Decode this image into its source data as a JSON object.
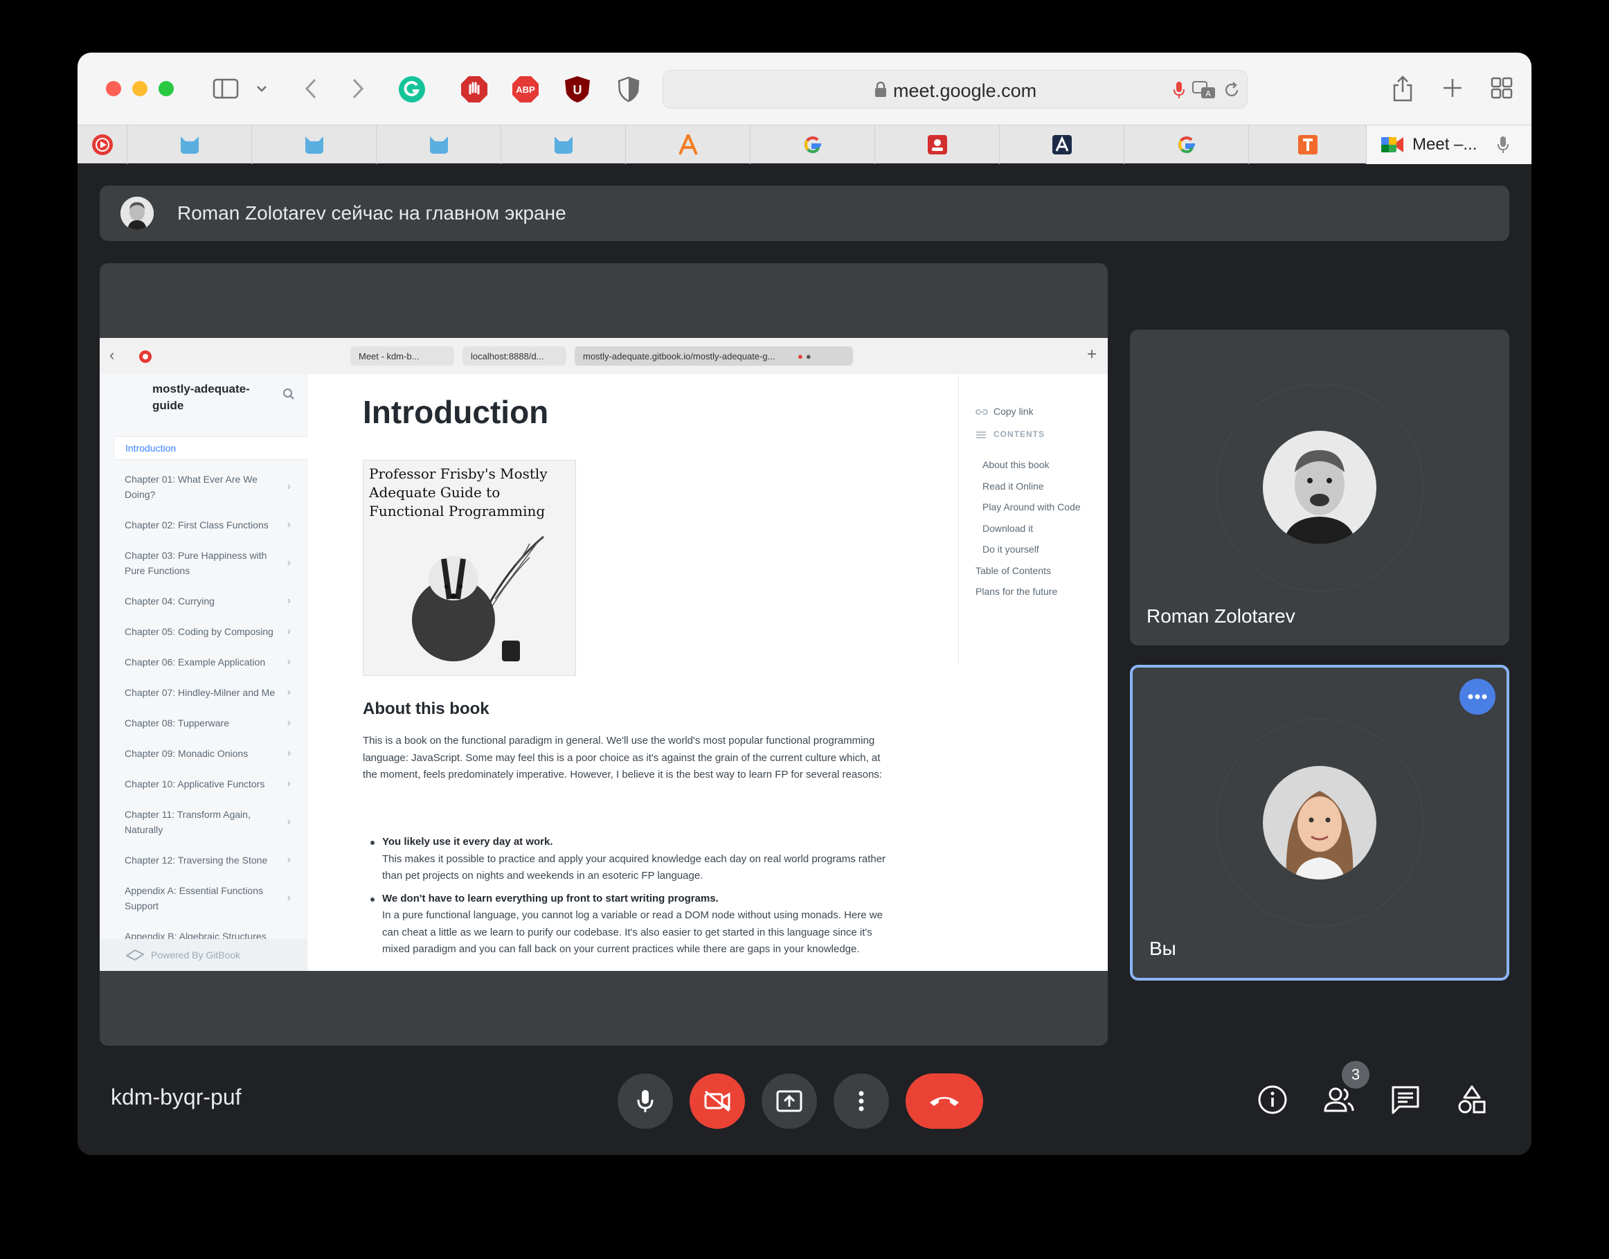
{
  "browser": {
    "url": "meet.google.com",
    "active_tab_label": "Meet –..."
  },
  "meet": {
    "banner_text": "Roman Zolotarev сейчас на главном экране",
    "meeting_code": "kdm-byqr-puf",
    "participants_count": "3",
    "tiles": [
      {
        "name": "Roman Zolotarev"
      },
      {
        "name": "Вы"
      }
    ]
  },
  "shared_screen": {
    "tabs": [
      "Meet - kdm-b...",
      "localhost:8888/d...",
      "mostly-adequate.gitbook.io/mostly-adequate-g..."
    ],
    "brand": "mostly-adequate-guide",
    "nav": [
      "Introduction",
      "Chapter 01: What Ever Are We Doing?",
      "Chapter 02: First Class Functions",
      "Chapter 03: Pure Happiness with Pure Functions",
      "Chapter 04: Currying",
      "Chapter 05: Coding by Composing",
      "Chapter 06: Example Application",
      "Chapter 07: Hindley-Milner and Me",
      "Chapter 08: Tupperware",
      "Chapter 09: Monadic Onions",
      "Chapter 10: Applicative Functors",
      "Chapter 11: Transform Again, Naturally",
      "Chapter 12: Traversing the Stone",
      "Appendix A: Essential Functions Support",
      "Appendix B: Algebraic Structures Support"
    ],
    "powered_by": "Powered By GitBook",
    "title": "Introduction",
    "cover_text": "Professor Frisby's Mostly Adequate Guide to Functional Programming",
    "section_title": "About this book",
    "paragraph": "This is a book on the functional paradigm in general. We'll use the world's most popular functional programming language: JavaScript. Some may feel this is a poor choice as it's against the grain of the current culture which, at the moment, feels predominately imperative. However, I believe it is the best way to learn FP for several reasons:",
    "bullets": [
      {
        "title": "You likely use it every day at work.",
        "text": "This makes it possible to practice and apply your acquired knowledge each day on real world programs rather than pet projects on nights and weekends in an esoteric FP language."
      },
      {
        "title": "We don't have to learn everything up front to start writing programs.",
        "text": "In a pure functional language, you cannot log a variable or read a DOM node without using monads. Here we can cheat a little as we learn to purify our codebase. It's also easier to get started in this language since it's mixed paradigm and you can fall back on your current practices while there are gaps in your knowledge."
      }
    ],
    "copy_link": "Copy link",
    "contents_label": "CONTENTS",
    "toc": [
      "About this book",
      "Read it Online",
      "Play Around with Code",
      "Download it",
      "Do it yourself",
      "Table of Contents",
      "Plans for the future"
    ]
  },
  "colors": {
    "meet_bg": "#202124",
    "tile_bg": "#3c4043",
    "danger": "#ea4335",
    "highlight": "#8ab4f8",
    "link": "#3884ff"
  }
}
